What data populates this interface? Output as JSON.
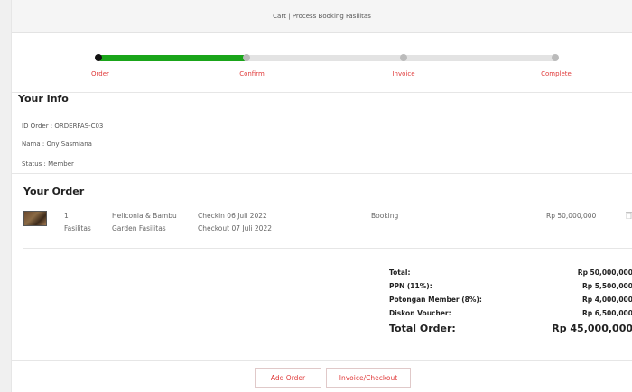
{
  "header": {
    "title": "Cart | Process Booking Fasilitas"
  },
  "stepper": {
    "steps": [
      {
        "label": "Order"
      },
      {
        "label": "Confirm"
      },
      {
        "label": "Invoice"
      },
      {
        "label": "Complete"
      }
    ],
    "progress": 0.33,
    "colors": {
      "active": "#1aa51a",
      "label": "#e03c3c"
    }
  },
  "info": {
    "title": "Your Info",
    "id_order": "ID Order : ORDERFAS-C03",
    "name": "Nama : Ony Sasmiana",
    "status": "Status : Member"
  },
  "order": {
    "title": "Your Order",
    "items": [
      {
        "qty": "1",
        "unit": "Fasilitas",
        "name_line1": "Heliconia & Bambu",
        "name_line2": "Garden Fasilitas",
        "checkin": "Checkin 06 Juli 2022",
        "checkout": "Checkout 07 Juli 2022",
        "type": "Booking",
        "price": "Rp 50,000,000"
      }
    ]
  },
  "totals": {
    "total_label": "Total:",
    "total_value": "Rp 50,000,000",
    "ppn_label": "PPN (11%):",
    "ppn_value": "Rp 5,500,000",
    "member_label": "Potongan Member (8%):",
    "member_value": "Rp 4,000,000",
    "voucher_label": "Diskon Voucher:",
    "voucher_value": "Rp 6,500,000",
    "grand_label": "Total Order:",
    "grand_value": "Rp 45,000,000"
  },
  "footer": {
    "add_order": "Add Order",
    "checkout": "Invoice/Checkout"
  }
}
